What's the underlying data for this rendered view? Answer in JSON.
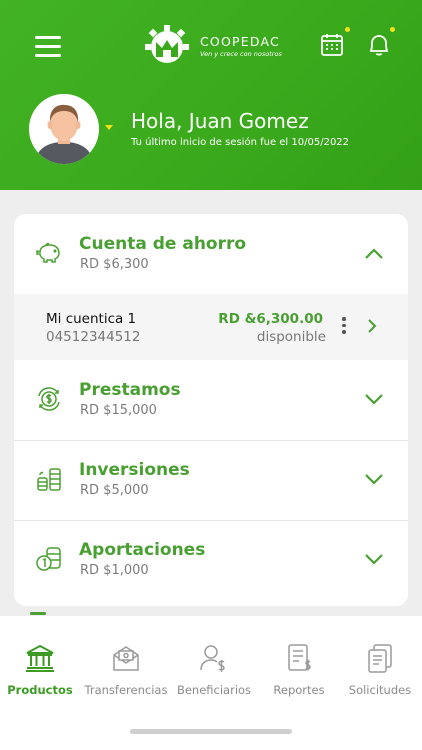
{
  "header": {
    "menu_icon": "hamburger-menu-icon",
    "logo": {
      "name": "COOPEDAC",
      "tagline": "Ven y crece con nosotros"
    },
    "calendar_icon": "calendar-icon",
    "bell_icon": "bell-icon",
    "greeting": "Hola, Juan Gomez",
    "last_login": "Tu último inicio de sesión fue el 10/05/2022"
  },
  "accounts": {
    "savings": {
      "title": "Cuenta de ahorro",
      "amount": "RD $6,300",
      "icon": "piggy-bank-icon",
      "expanded": true,
      "items": [
        {
          "name": "Mi cuentica 1",
          "number": "04512344512",
          "amount": "RD &6,300.00",
          "status": "disponible"
        }
      ]
    },
    "loans": {
      "title": "Prestamos",
      "amount": "RD $15,000",
      "icon": "loan-cycle-icon"
    },
    "investments": {
      "title": "Inversiones",
      "amount": "RD $5,000",
      "icon": "coin-stack-icon"
    },
    "contributions": {
      "title": "Aportaciones",
      "amount": "RD $1,000",
      "icon": "coins-icon"
    }
  },
  "tabs": [
    {
      "label": "Productos",
      "icon": "bank-icon",
      "active": true
    },
    {
      "label": "Transferencias",
      "icon": "transfer-envelope-icon",
      "active": false
    },
    {
      "label": "Beneficiarios",
      "icon": "beneficiary-user-icon",
      "active": false
    },
    {
      "label": "Reportes",
      "icon": "report-document-icon",
      "active": false
    },
    {
      "label": "Solicitudes",
      "icon": "requests-documents-icon",
      "active": false
    }
  ],
  "colors": {
    "primary_green": "#42b324",
    "text_green": "#4a9f33",
    "notification_dot": "#f3e21a"
  }
}
